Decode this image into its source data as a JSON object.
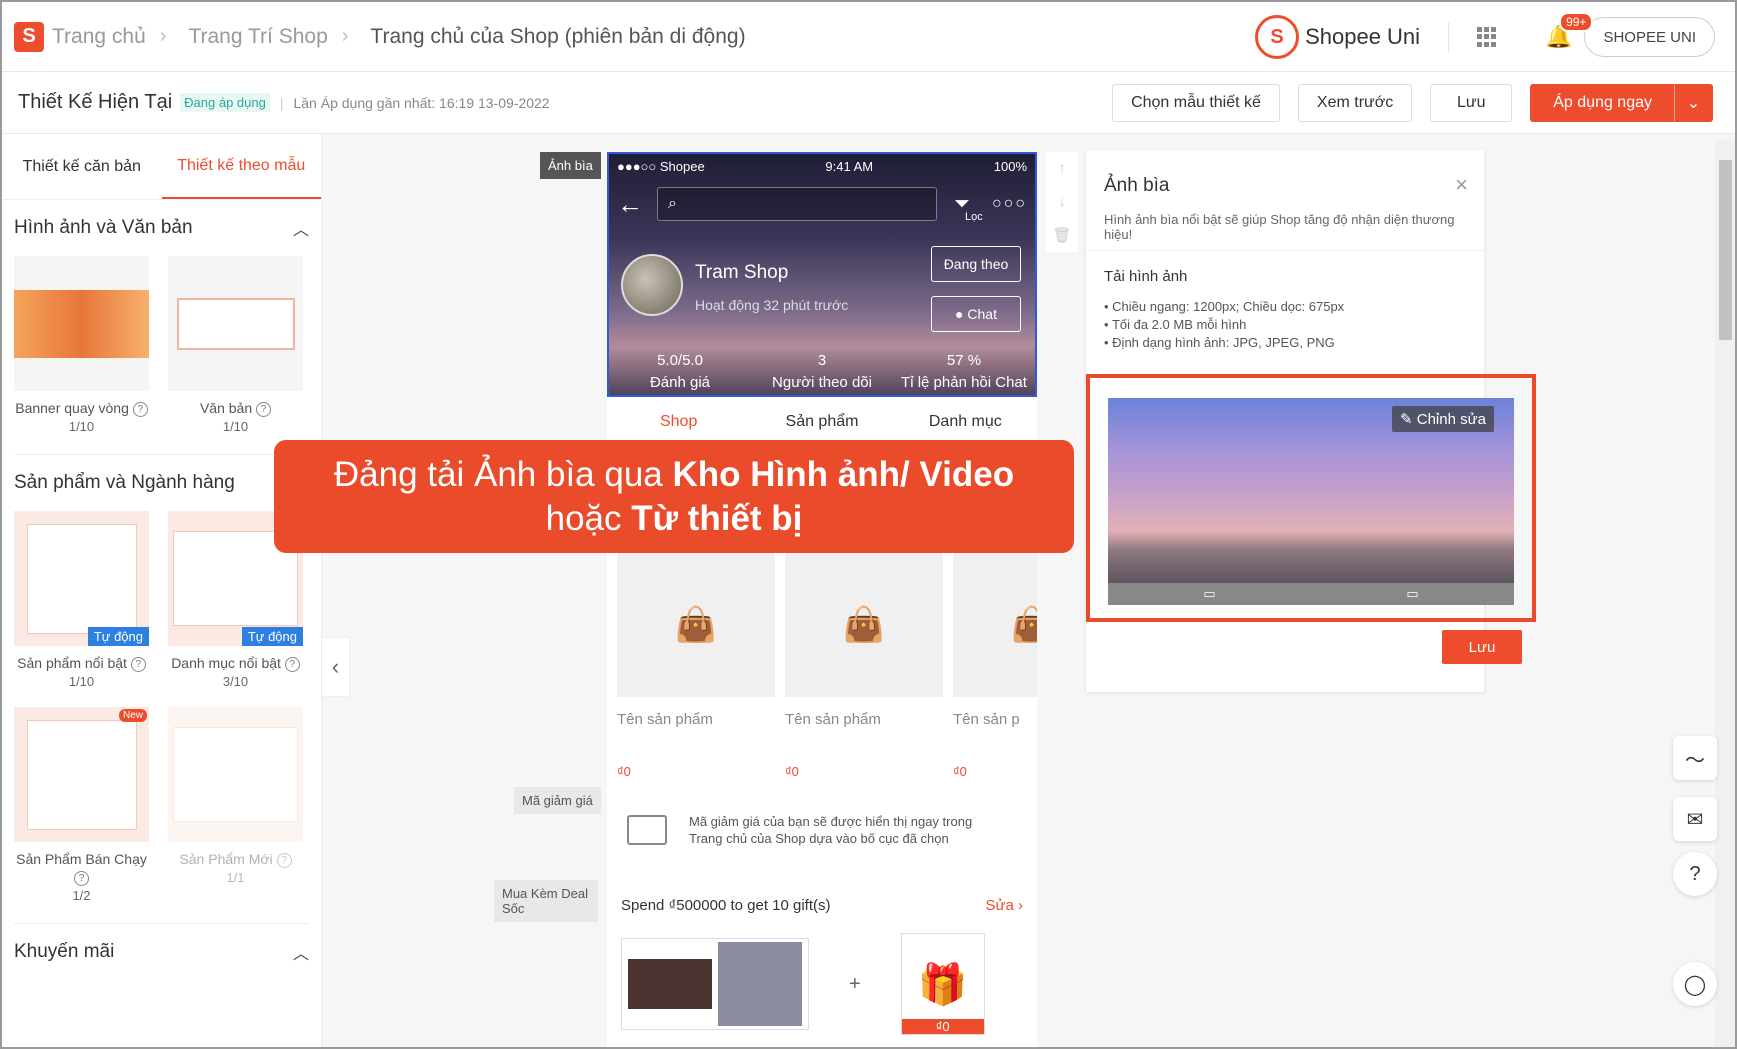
{
  "breadcrumb": {
    "home": "Trang chủ",
    "shop_deco": "Trang Trí Shop",
    "current": "Trang chủ của Shop (phiên bản di động)"
  },
  "header": {
    "uni_label": "Shopee Uni",
    "notif_badge": "99+",
    "user": "SHOPEE UNI"
  },
  "subbar": {
    "title": "Thiết Kế Hiện Tại",
    "status": "Đang áp dụng",
    "last_applied": "Lần Áp dụng gần nhất: 16:19 13-09-2022",
    "choose_template": "Chọn mẫu thiết kế",
    "preview": "Xem trước",
    "save": "Lưu",
    "apply_now": "Áp dụng ngay"
  },
  "left": {
    "tabs": [
      "Thiết kế căn bản",
      "Thiết kế theo mẫu"
    ],
    "sections": [
      {
        "title": "Hình ảnh và Văn bản",
        "items": [
          {
            "label": "Banner quay vòng",
            "count": "1/10"
          },
          {
            "label": "Văn bản",
            "count": "1/10"
          }
        ]
      },
      {
        "title": "Sản phẩm và Ngành hàng",
        "items": [
          {
            "label": "Sản phẩm nổi bật",
            "count": "1/10",
            "tag": "Tự động"
          },
          {
            "label": "Danh mục nổi bật",
            "count": "3/10",
            "tag": "Tự động"
          },
          {
            "label": "Sản Phẩm Bán Chạy",
            "count": "1/2",
            "tag": "New"
          },
          {
            "label": "Sản Phẩm Mới",
            "count": "1/1"
          }
        ]
      },
      {
        "title": "Khuyến mãi"
      }
    ]
  },
  "phone": {
    "cover_label": "Ảnh bìa",
    "carrier": "●●●○○ Shopee",
    "time": "9:41 AM",
    "battery": "100%",
    "filter_label": "Lọc",
    "shop_name": "Tram Shop",
    "active": "Hoạt động 32 phút trước",
    "follow": "Đang theo",
    "chat": "Chat",
    "stats": [
      {
        "value": "5.0/5.0",
        "label": "Đánh giá"
      },
      {
        "value": "3",
        "label": "Người theo dõi"
      },
      {
        "value": "57 %",
        "label": "Tỉ lệ phản hồi Chat"
      }
    ],
    "tabs": [
      "Shop",
      "Sản phẩm",
      "Danh mục"
    ],
    "products": [
      {
        "name": "Tên sản phẩm",
        "price": "₫0"
      },
      {
        "name": "Tên sản phẩm",
        "price": "₫0"
      },
      {
        "name": "Tên sản p",
        "price": "₫0"
      }
    ],
    "voucher_label": "Mã giảm giá",
    "voucher_text_1": "Mã giảm giá của bạn sẽ được hiển thị ngay trong",
    "voucher_text_2": "Trang chủ của Shop dựa vào bố cục đã chọn",
    "deal_label": "Mua Kèm Deal Sốc",
    "deal_title": "Spend ₫500000 to get 10 gift(s)",
    "deal_edit": "Sửa",
    "gift_price": "₫0"
  },
  "panel": {
    "title": "Ảnh bìa",
    "desc": "Hình ảnh bìa nổi bật sẽ giúp Shop tăng độ nhận diện thương hiệu!",
    "upload_title": "Tải hình ảnh",
    "specs": [
      "Chiều ngang: 1200px; Chiều dọc: 675px",
      "Tối đa 2.0 MB mỗi hình",
      "Định dạng hình ảnh: JPG, JPEG, PNG"
    ],
    "edit": "Chỉnh sửa",
    "save": "Lưu"
  },
  "callout": {
    "line1_a": "Đảng tải Ảnh bìa qua ",
    "line1_b": "Kho Hình ảnh/ Video",
    "line2_a": "hoặc ",
    "line2_b": "Từ thiết bị"
  },
  "colors": {
    "brand": "#ee4d2d",
    "highlight": "#e94b2b",
    "link_blue": "#2d7fe0"
  }
}
